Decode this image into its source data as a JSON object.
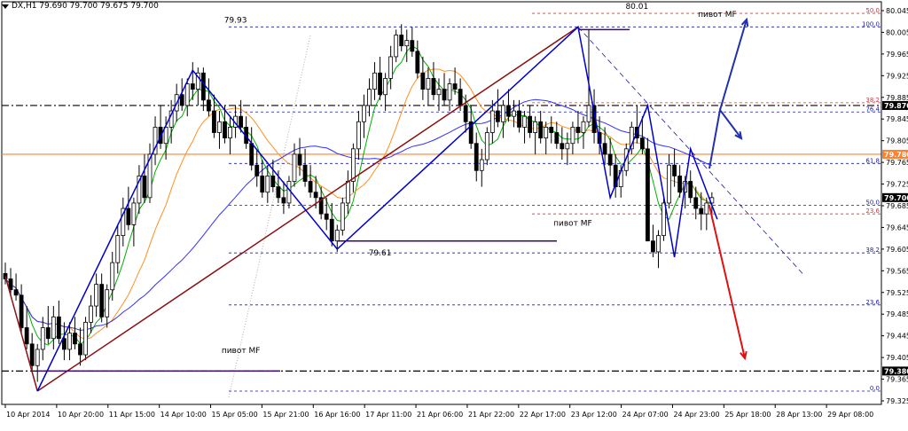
{
  "header": {
    "symbol_info": "DX,H1  79.690 79.700 79.675 79.700"
  },
  "colors": {
    "bg": "#ffffff",
    "axis": "#000000",
    "grid_dots": "#b0b0b0",
    "candle": "#000000",
    "ma_fast": "#00b000",
    "ma_mid": "#ff9020",
    "ma_slow": "#3030ff",
    "trend_red": "#8b1010",
    "wave_blue": "#0000cc",
    "pivot_purple": "#3a0a6a",
    "fib_blue": "#1a1aa0",
    "fib_red": "#c04040",
    "level_orange": "#ff8030",
    "arrow_blue": "#2030b0",
    "arrow_red": "#e01010"
  },
  "chart_data": {
    "type": "candlestick",
    "title": "",
    "symbol": "DX",
    "timeframe": "H1",
    "ylim": [
      79.325,
      80.045
    ],
    "y_ticks": [
      "80.045",
      "80.005",
      "79.965",
      "79.925",
      "79.885",
      "79.845",
      "79.805",
      "79.765",
      "79.725",
      "79.685",
      "79.645",
      "79.605",
      "79.565",
      "79.525",
      "79.485",
      "79.445",
      "79.405",
      "79.365",
      "79.325"
    ],
    "x_ticks": [
      "10 Apr 2014",
      "10 Apr 20:00",
      "11 Apr 15:00",
      "14 Apr 10:00",
      "15 Apr 05:00",
      "15 Apr 21:00",
      "16 Apr 16:00",
      "17 Apr 11:00",
      "21 Apr 06:00",
      "21 Apr 22:00",
      "22 Apr 17:00",
      "23 Apr 12:00",
      "24 Apr 07:00",
      "24 Apr 23:00",
      "25 Apr 18:00",
      "28 Apr 13:00",
      "29 Apr 08:00"
    ],
    "price_labels": [
      {
        "text": "79.870",
        "value": 79.87,
        "style": "black"
      },
      {
        "text": "79.780",
        "value": 79.78,
        "style": "orange"
      },
      {
        "text": "79.700",
        "value": 79.7,
        "style": "black"
      },
      {
        "text": "79.380",
        "value": 79.38,
        "style": "black"
      }
    ],
    "horizontal_levels": [
      {
        "value": 79.87,
        "style": "dashdot",
        "color": "#000000"
      },
      {
        "value": 79.78,
        "style": "solid",
        "color": "#ff8030"
      },
      {
        "value": 79.38,
        "style": "dashdot",
        "color": "#000000"
      }
    ],
    "fib_levels": [
      {
        "label": "100.0",
        "value": 80.015,
        "color": "blue"
      },
      {
        "label": "76.4",
        "value": 79.858,
        "color": "blue"
      },
      {
        "label": "61.8",
        "value": 79.763,
        "color": "blue"
      },
      {
        "label": "50.0",
        "value": 79.686,
        "color": "blue"
      },
      {
        "label": "38.2",
        "value": 79.598,
        "color": "blue"
      },
      {
        "label": "23.6",
        "value": 79.502,
        "color": "blue"
      },
      {
        "label": "0.0",
        "value": 79.343,
        "color": "blue"
      },
      {
        "label": "50.0",
        "value": 80.04,
        "color": "red"
      },
      {
        "label": "38.2",
        "value": 79.875,
        "color": "red"
      },
      {
        "label": "23.6",
        "value": 79.67,
        "color": "red"
      }
    ],
    "annotations": [
      {
        "text": "80.01",
        "bar": 118,
        "value": 80.045
      },
      {
        "text": "79.93",
        "bar": 43,
        "value": 80.02
      },
      {
        "text": "79.61",
        "bar": 70,
        "value": 79.59
      },
      {
        "text": "пивот MF",
        "bar": 133,
        "value": 80.03
      },
      {
        "text": "пивот MF",
        "bar": 106,
        "value": 79.645
      },
      {
        "text": "пивот MF",
        "bar": 44,
        "value": 79.41
      }
    ],
    "ohlc": [
      [
        79.56,
        79.58,
        79.54,
        79.55
      ],
      [
        79.55,
        79.57,
        79.52,
        79.53
      ],
      [
        79.53,
        79.56,
        79.51,
        79.52
      ],
      [
        79.52,
        79.54,
        79.45,
        79.46
      ],
      [
        79.46,
        79.5,
        79.42,
        79.43
      ],
      [
        79.43,
        79.45,
        79.38,
        79.39
      ],
      [
        79.39,
        79.43,
        79.36,
        79.42
      ],
      [
        79.42,
        79.48,
        79.4,
        79.46
      ],
      [
        79.46,
        79.5,
        79.43,
        79.44
      ],
      [
        79.44,
        79.5,
        79.42,
        79.48
      ],
      [
        79.48,
        79.51,
        79.43,
        79.44
      ],
      [
        79.44,
        79.47,
        79.4,
        79.42
      ],
      [
        79.42,
        79.47,
        79.4,
        79.45
      ],
      [
        79.45,
        79.48,
        79.42,
        79.43
      ],
      [
        79.43,
        79.46,
        79.39,
        79.41
      ],
      [
        79.41,
        79.48,
        79.4,
        79.47
      ],
      [
        79.47,
        79.52,
        79.45,
        79.5
      ],
      [
        79.5,
        79.56,
        79.48,
        79.54
      ],
      [
        79.54,
        79.56,
        79.47,
        79.48
      ],
      [
        79.48,
        79.54,
        79.46,
        79.53
      ],
      [
        79.53,
        79.6,
        79.51,
        79.58
      ],
      [
        79.58,
        79.65,
        79.56,
        79.63
      ],
      [
        79.63,
        79.7,
        79.61,
        79.68
      ],
      [
        79.68,
        79.72,
        79.64,
        79.65
      ],
      [
        79.65,
        79.7,
        79.61,
        79.69
      ],
      [
        79.69,
        79.76,
        79.67,
        79.74
      ],
      [
        79.74,
        79.78,
        79.69,
        79.7
      ],
      [
        79.7,
        79.8,
        79.69,
        79.78
      ],
      [
        79.78,
        79.85,
        79.76,
        79.83
      ],
      [
        79.83,
        79.87,
        79.79,
        79.8
      ],
      [
        79.8,
        79.85,
        79.77,
        79.83
      ],
      [
        79.83,
        79.88,
        79.8,
        79.86
      ],
      [
        79.86,
        79.91,
        79.84,
        79.89
      ],
      [
        79.89,
        79.92,
        79.86,
        79.87
      ],
      [
        79.87,
        79.92,
        79.85,
        79.91
      ],
      [
        79.91,
        79.95,
        79.88,
        79.9
      ],
      [
        79.9,
        79.94,
        79.87,
        79.93
      ],
      [
        79.93,
        79.94,
        79.86,
        79.88
      ],
      [
        79.88,
        79.92,
        79.85,
        79.86
      ],
      [
        79.86,
        79.89,
        79.81,
        79.82
      ],
      [
        79.82,
        79.86,
        79.79,
        79.84
      ],
      [
        79.84,
        79.87,
        79.8,
        79.81
      ],
      [
        79.81,
        79.85,
        79.78,
        79.83
      ],
      [
        79.83,
        79.87,
        79.81,
        79.85
      ],
      [
        79.85,
        79.88,
        79.82,
        79.83
      ],
      [
        79.83,
        79.85,
        79.79,
        79.8
      ],
      [
        79.8,
        79.83,
        79.75,
        79.76
      ],
      [
        79.76,
        79.79,
        79.72,
        79.74
      ],
      [
        79.74,
        79.77,
        79.7,
        79.71
      ],
      [
        79.71,
        79.76,
        79.69,
        79.74
      ],
      [
        79.74,
        79.77,
        79.71,
        79.72
      ],
      [
        79.72,
        79.75,
        79.69,
        79.7
      ],
      [
        79.7,
        79.73,
        79.67,
        79.69
      ],
      [
        79.69,
        79.74,
        79.68,
        79.73
      ],
      [
        79.73,
        79.8,
        79.72,
        79.78
      ],
      [
        79.78,
        79.81,
        79.74,
        79.76
      ],
      [
        79.76,
        79.79,
        79.72,
        79.73
      ],
      [
        79.73,
        79.76,
        79.7,
        79.71
      ],
      [
        79.71,
        79.74,
        79.68,
        79.7
      ],
      [
        79.7,
        79.72,
        79.66,
        79.67
      ],
      [
        79.67,
        79.7,
        79.64,
        79.66
      ],
      [
        79.66,
        79.69,
        79.61,
        79.62
      ],
      [
        79.62,
        79.65,
        79.6,
        79.64
      ],
      [
        79.64,
        79.7,
        79.63,
        79.69
      ],
      [
        79.69,
        79.75,
        79.67,
        79.73
      ],
      [
        79.73,
        79.8,
        79.71,
        79.79
      ],
      [
        79.79,
        79.86,
        79.77,
        79.84
      ],
      [
        79.84,
        79.89,
        79.81,
        79.87
      ],
      [
        79.87,
        79.92,
        79.85,
        79.9
      ],
      [
        79.9,
        79.95,
        79.88,
        79.93
      ],
      [
        79.93,
        79.96,
        79.88,
        79.89
      ],
      [
        79.89,
        79.93,
        79.86,
        79.92
      ],
      [
        79.92,
        79.98,
        79.9,
        79.96
      ],
      [
        79.96,
        80.01,
        79.95,
        80.0
      ],
      [
        80.0,
        80.02,
        79.97,
        79.98
      ],
      [
        79.98,
        80.01,
        79.95,
        79.99
      ],
      [
        79.99,
        80.015,
        79.96,
        79.97
      ],
      [
        79.97,
        79.99,
        79.92,
        79.93
      ],
      [
        79.93,
        79.96,
        79.88,
        79.9
      ],
      [
        79.9,
        79.94,
        79.87,
        79.92
      ],
      [
        79.92,
        79.95,
        79.88,
        79.89
      ],
      [
        79.89,
        79.92,
        79.86,
        79.9
      ],
      [
        79.9,
        79.93,
        79.87,
        79.88
      ],
      [
        79.88,
        79.92,
        79.86,
        79.91
      ],
      [
        79.91,
        79.94,
        79.89,
        79.9
      ],
      [
        79.9,
        79.92,
        79.86,
        79.87
      ],
      [
        79.87,
        79.89,
        79.82,
        79.84
      ],
      [
        79.84,
        79.87,
        79.79,
        79.8
      ],
      [
        79.8,
        79.82,
        79.73,
        79.75
      ],
      [
        79.75,
        79.79,
        79.72,
        79.77
      ],
      [
        79.77,
        79.83,
        79.76,
        79.82
      ],
      [
        79.82,
        79.88,
        79.8,
        79.86
      ],
      [
        79.86,
        79.9,
        79.83,
        79.84
      ],
      [
        79.84,
        79.88,
        79.81,
        79.87
      ],
      [
        79.87,
        79.9,
        79.84,
        79.85
      ],
      [
        79.85,
        79.88,
        79.83,
        79.86
      ],
      [
        79.86,
        79.88,
        79.82,
        79.83
      ],
      [
        79.83,
        79.86,
        79.8,
        79.85
      ],
      [
        79.85,
        79.87,
        79.81,
        79.82
      ],
      [
        79.82,
        79.85,
        79.78,
        79.84
      ],
      [
        79.84,
        79.86,
        79.8,
        79.81
      ],
      [
        79.81,
        79.84,
        79.78,
        79.83
      ],
      [
        79.83,
        79.85,
        79.8,
        79.82
      ],
      [
        79.82,
        79.84,
        79.79,
        79.8
      ],
      [
        79.8,
        79.83,
        79.77,
        79.79
      ],
      [
        79.79,
        79.82,
        79.76,
        79.8
      ],
      [
        79.8,
        79.84,
        79.78,
        79.83
      ],
      [
        79.83,
        79.86,
        79.8,
        79.82
      ],
      [
        79.82,
        79.85,
        79.79,
        79.84
      ],
      [
        79.84,
        80.01,
        79.83,
        79.87
      ],
      [
        79.87,
        79.9,
        79.8,
        79.82
      ],
      [
        79.82,
        79.85,
        79.78,
        79.8
      ],
      [
        79.8,
        79.83,
        79.76,
        79.78
      ],
      [
        79.78,
        79.81,
        79.74,
        79.76
      ],
      [
        79.76,
        79.78,
        79.7,
        79.72
      ],
      [
        79.72,
        79.76,
        79.7,
        79.75
      ],
      [
        79.75,
        79.8,
        79.74,
        79.79
      ],
      [
        79.79,
        79.84,
        79.78,
        79.83
      ],
      [
        79.83,
        79.87,
        79.8,
        79.81
      ],
      [
        79.81,
        79.85,
        79.78,
        79.79
      ],
      [
        79.79,
        79.81,
        79.7,
        79.62
      ],
      [
        79.62,
        79.65,
        79.59,
        79.6
      ],
      [
        79.6,
        79.64,
        79.57,
        79.63
      ],
      [
        79.63,
        79.7,
        79.62,
        79.69
      ],
      [
        79.69,
        79.78,
        79.68,
        79.76
      ],
      [
        79.76,
        79.79,
        79.72,
        79.74
      ],
      [
        79.74,
        79.76,
        79.7,
        79.71
      ],
      [
        79.71,
        79.74,
        79.68,
        79.73
      ],
      [
        79.73,
        79.75,
        79.69,
        79.7
      ],
      [
        79.7,
        79.72,
        79.66,
        79.68
      ],
      [
        79.68,
        79.71,
        79.64,
        79.67
      ],
      [
        79.67,
        79.7,
        79.64,
        79.69
      ],
      [
        79.69,
        79.71,
        79.66,
        79.7
      ]
    ]
  }
}
